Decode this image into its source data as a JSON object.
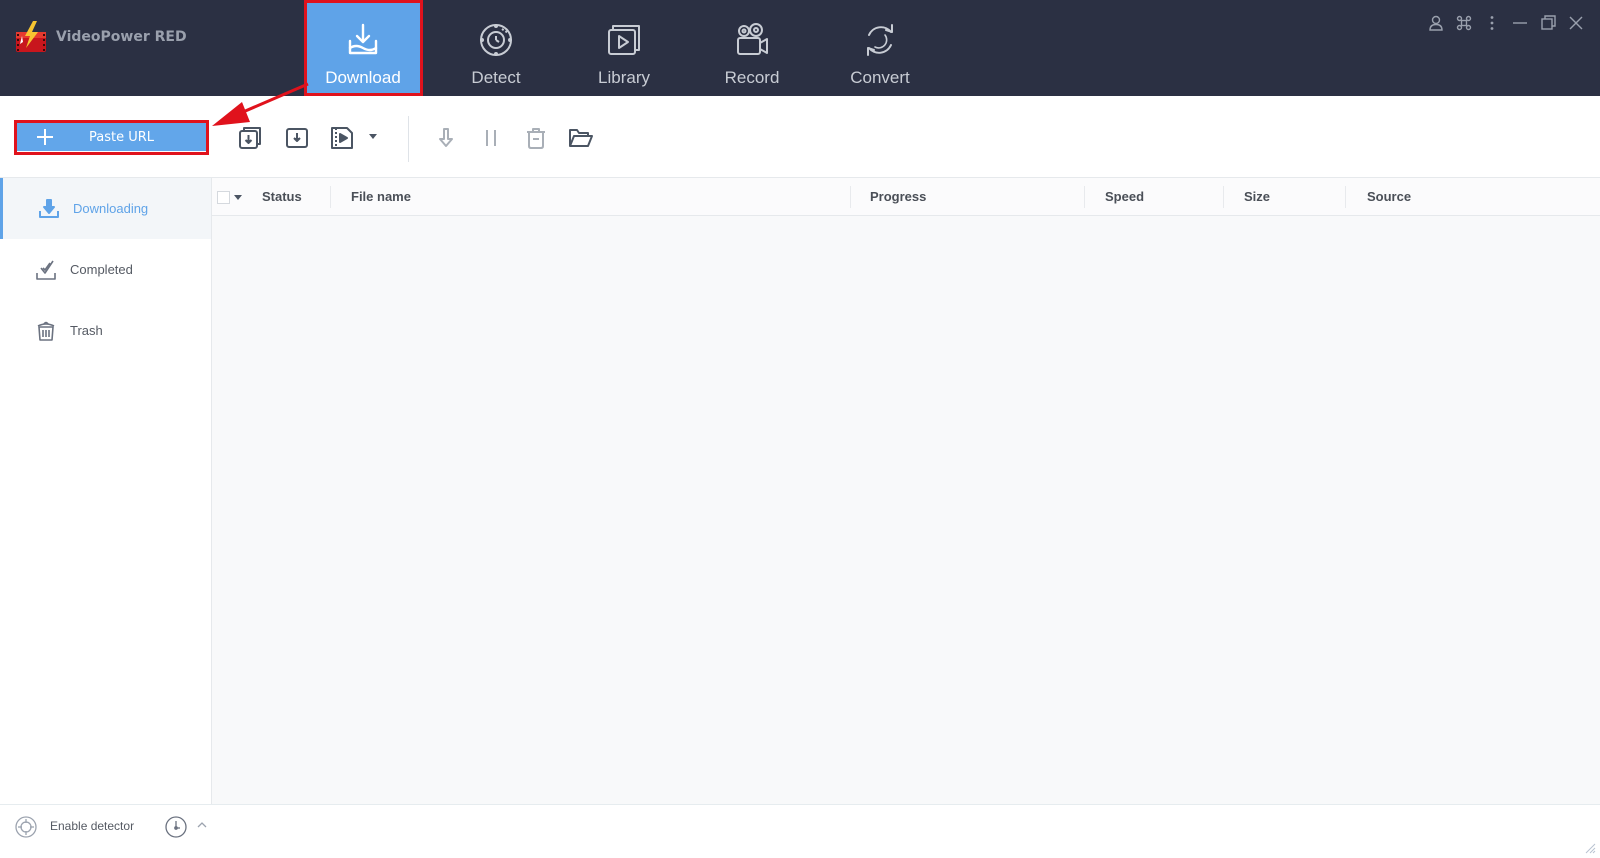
{
  "app": {
    "title": "VideoPower RED"
  },
  "nav": {
    "items": [
      {
        "id": "download",
        "label": "Download",
        "icon": "download-tray-icon",
        "active": true
      },
      {
        "id": "detect",
        "label": "Detect",
        "icon": "detect-target-icon",
        "active": false
      },
      {
        "id": "library",
        "label": "Library",
        "icon": "library-play-icon",
        "active": false
      },
      {
        "id": "record",
        "label": "Record",
        "icon": "video-camera-icon",
        "active": false
      },
      {
        "id": "convert",
        "label": "Convert",
        "icon": "convert-cycle-icon",
        "active": false
      }
    ]
  },
  "window_controls": {
    "icons": [
      "user-icon",
      "command-icon",
      "more-vertical-icon",
      "minimize-icon",
      "restore-icon",
      "close-icon"
    ]
  },
  "toolbar": {
    "paste_url_label": "Paste URL",
    "icons": [
      "batch-download-icon",
      "download-icon",
      "video-file-icon",
      "dropdown-caret-icon",
      "resume-icon",
      "pause-icon",
      "delete-icon",
      "open-folder-icon"
    ]
  },
  "sidebar": {
    "items": [
      {
        "id": "downloading",
        "label": "Downloading",
        "icon": "downloading-icon",
        "active": true
      },
      {
        "id": "completed",
        "label": "Completed",
        "icon": "completed-check-icon",
        "active": false
      },
      {
        "id": "trash",
        "label": "Trash",
        "icon": "trash-icon",
        "active": false
      }
    ]
  },
  "table": {
    "columns": [
      "Status",
      "File name",
      "Progress",
      "Speed",
      "Size",
      "Source"
    ],
    "rows": []
  },
  "footer": {
    "enable_detector_label": "Enable detector"
  },
  "colors": {
    "topbar_bg": "#2b3043",
    "accent": "#5fa3e8",
    "highlight": "#e0121c"
  }
}
